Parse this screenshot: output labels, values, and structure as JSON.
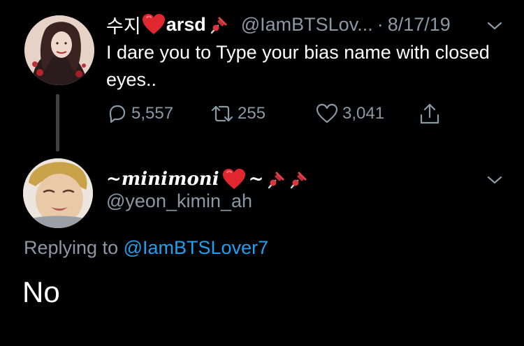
{
  "parent_tweet": {
    "name_korean": "수지",
    "name_latin": "arsd",
    "heart_emoji": "heart-emoji",
    "pin_emoji": "pushpin-emoji",
    "handle": "@IamBTSLov...",
    "separator": "·",
    "date": "8/17/19",
    "text": "I dare you to Type your bias name with closed eyes..",
    "replies": "5,557",
    "retweets": "255",
    "likes": "3,041",
    "icons": [
      "reply-icon",
      "retweet-icon",
      "like-icon",
      "share-icon",
      "chevron-down-icon"
    ]
  },
  "reply_tweet": {
    "name_prefix": "~minimoni",
    "name_suffix": "~",
    "handle": "@yeon_kimin_ah",
    "replying_to_label": "Replying to",
    "replying_to_handle": "@IamBTSLover7",
    "text": "No"
  },
  "colors": {
    "background": "#000000",
    "text_primary": "#ffffff",
    "text_secondary": "#8b98a5",
    "link": "#1da1f2",
    "heart_red": "#e0262f",
    "pin_red": "#d9363e",
    "thread_line": "#3d4247"
  }
}
